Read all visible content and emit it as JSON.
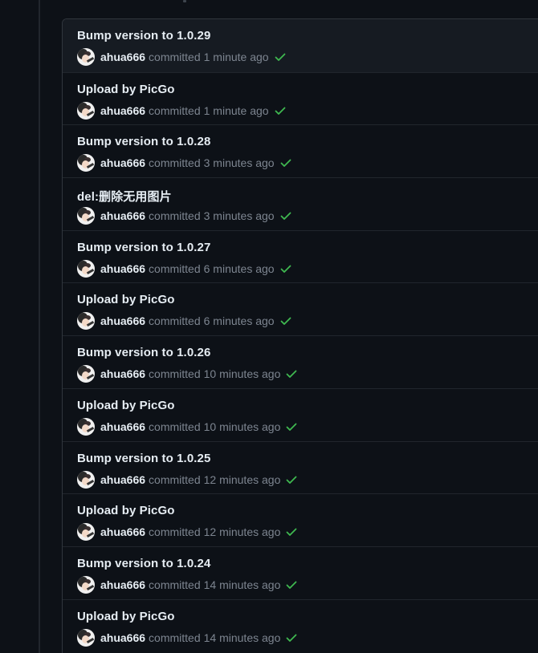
{
  "commits": [
    {
      "title": "Bump version to 1.0.29",
      "author": "ahua666",
      "verb": "committed",
      "time": "1 minute ago",
      "status": "success"
    },
    {
      "title": "Upload by PicGo",
      "author": "ahua666",
      "verb": "committed",
      "time": "1 minute ago",
      "status": "success"
    },
    {
      "title": "Bump version to 1.0.28",
      "author": "ahua666",
      "verb": "committed",
      "time": "3 minutes ago",
      "status": "success"
    },
    {
      "title": "del:删除无用图片",
      "author": "ahua666",
      "verb": "committed",
      "time": "3 minutes ago",
      "status": "success"
    },
    {
      "title": "Bump version to 1.0.27",
      "author": "ahua666",
      "verb": "committed",
      "time": "6 minutes ago",
      "status": "success"
    },
    {
      "title": "Upload by PicGo",
      "author": "ahua666",
      "verb": "committed",
      "time": "6 minutes ago",
      "status": "success"
    },
    {
      "title": "Bump version to 1.0.26",
      "author": "ahua666",
      "verb": "committed",
      "time": "10 minutes ago",
      "status": "success"
    },
    {
      "title": "Upload by PicGo",
      "author": "ahua666",
      "verb": "committed",
      "time": "10 minutes ago",
      "status": "success"
    },
    {
      "title": "Bump version to 1.0.25",
      "author": "ahua666",
      "verb": "committed",
      "time": "12 minutes ago",
      "status": "success"
    },
    {
      "title": "Upload by PicGo",
      "author": "ahua666",
      "verb": "committed",
      "time": "12 minutes ago",
      "status": "success"
    },
    {
      "title": "Bump version to 1.0.24",
      "author": "ahua666",
      "verb": "committed",
      "time": "14 minutes ago",
      "status": "success"
    },
    {
      "title": "Upload by PicGo",
      "author": "ahua666",
      "verb": "committed",
      "time": "14 minutes ago",
      "status": "success"
    }
  ],
  "icons": {
    "avatar": "avatar-icon",
    "status": "check-icon"
  },
  "colors": {
    "background": "#0d1117",
    "border": "#30363d",
    "text_primary": "#e6edf3",
    "text_muted": "#7d8590",
    "success": "#3fb950"
  }
}
